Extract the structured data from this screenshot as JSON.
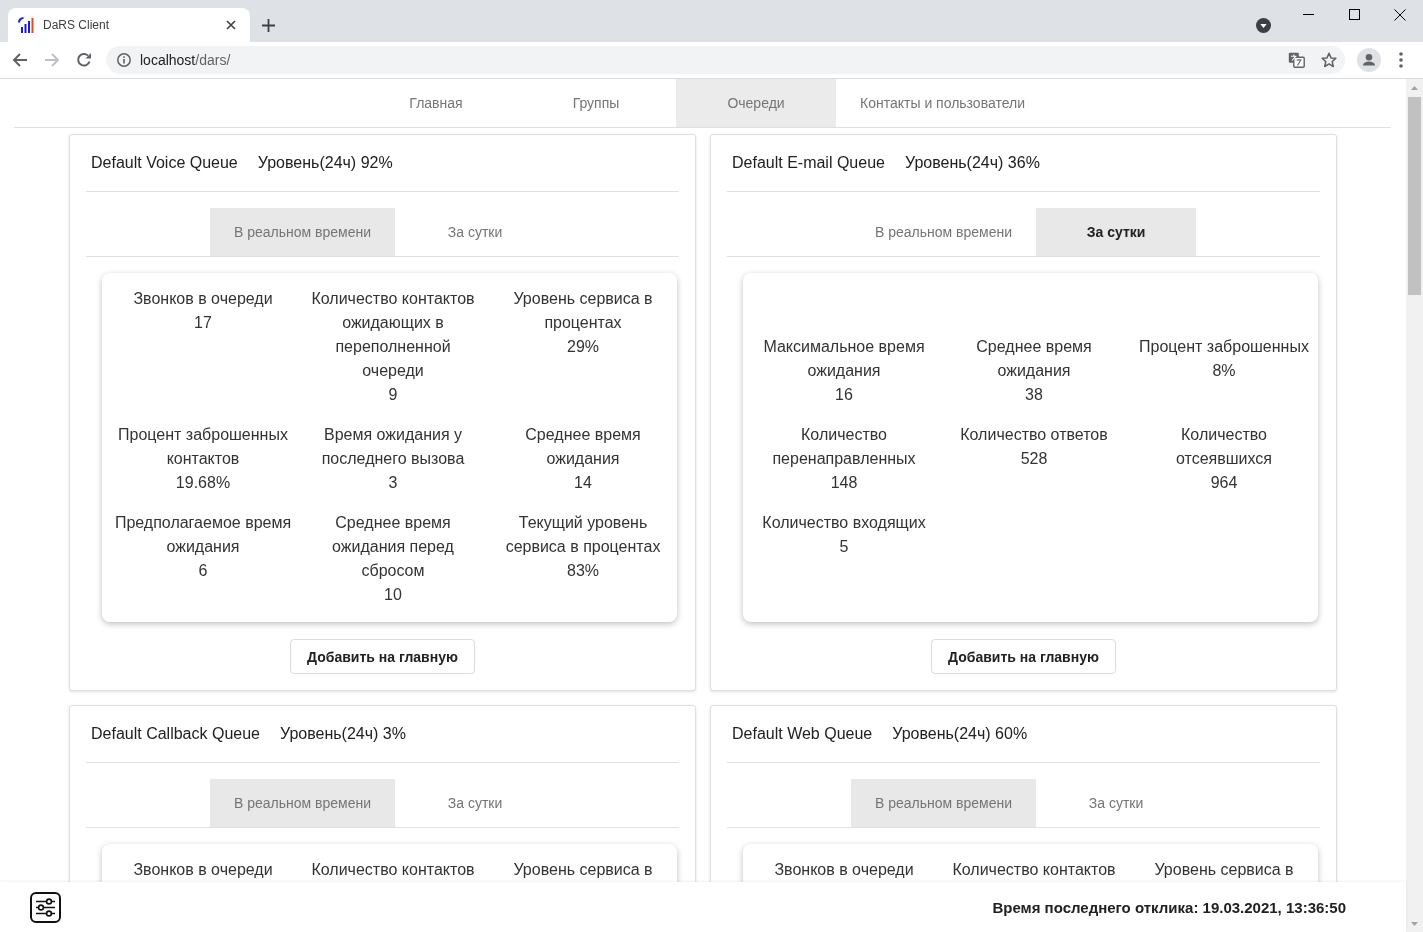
{
  "browser": {
    "tab": {
      "title": "DaRS Client"
    },
    "nav_buttons": [
      {
        "kind": "back",
        "disabled": false
      },
      {
        "kind": "forward",
        "disabled": true
      },
      {
        "kind": "reload",
        "disabled": false
      }
    ],
    "address": {
      "host": "localhost",
      "path": "/dars/"
    }
  },
  "nav": {
    "items": [
      {
        "label": "Главная",
        "selected": false
      },
      {
        "label": "Группы",
        "selected": false
      },
      {
        "label": "Очереди",
        "selected": true
      },
      {
        "label": "Контакты и пользователи",
        "selected": false
      }
    ]
  },
  "queues": [
    {
      "name": "Default Voice Queue",
      "service_level": "Уровень(24ч) 92%",
      "tabs": [
        {
          "label": "В реальном времени",
          "selected": true,
          "focused": false
        },
        {
          "label": "За сутки",
          "selected": false,
          "focused": false
        }
      ],
      "stats": [
        {
          "label": "Звонков в очереди",
          "value": "17"
        },
        {
          "label": "Количество контактов ожидающих в переполненной очереди",
          "value": "9"
        },
        {
          "label": "Уровень сервиса в процентах",
          "value": "29%"
        },
        {
          "label": "Процент заброшенных контактов",
          "value": "19.68%"
        },
        {
          "label": "Время ожидания у последнего вызова",
          "value": "3"
        },
        {
          "label": "Среднее время ожидания",
          "value": "14"
        },
        {
          "label": "Предполагаемое время ожидания",
          "value": "6"
        },
        {
          "label": "Среднее время ожидания перед сбросом",
          "value": "10"
        },
        {
          "label": "Текущий уровень сервиса в процентах",
          "value": "83%"
        }
      ],
      "button": "Добавить на главную"
    },
    {
      "name": "Default E-mail Queue",
      "service_level": "Уровень(24ч) 36%",
      "tabs": [
        {
          "label": "В реальном времени",
          "selected": false,
          "focused": false
        },
        {
          "label": "За сутки",
          "selected": true,
          "focused": true
        }
      ],
      "stats": [
        {
          "label": "Максимальное время ожидания",
          "value": "16"
        },
        {
          "label": "Среднее время ожидания",
          "value": "38"
        },
        {
          "label": "Процент заброшенных",
          "value": "8%"
        },
        {
          "label": "Количество перенаправленных",
          "value": "148"
        },
        {
          "label": "Количество ответов",
          "value": "528"
        },
        {
          "label": "Количество отсеявшихся",
          "value": "964"
        },
        {
          "label": "Количество входящих",
          "value": "5"
        }
      ],
      "button": "Добавить на главную"
    },
    {
      "name": "Default Callback Queue",
      "service_level": "Уровень(24ч) 3%",
      "tabs": [
        {
          "label": "В реальном времени",
          "selected": true,
          "focused": false
        },
        {
          "label": "За сутки",
          "selected": false,
          "focused": false
        }
      ],
      "stats": [
        {
          "label": "Звонков в очереди"
        },
        {
          "label": "Количество контактов"
        },
        {
          "label": "Уровень сервиса в"
        }
      ]
    },
    {
      "name": "Default Web Queue",
      "service_level": "Уровень(24ч) 60%",
      "tabs": [
        {
          "label": "В реальном времени",
          "selected": true,
          "focused": false
        },
        {
          "label": "За сутки",
          "selected": false,
          "focused": false
        }
      ],
      "stats": [
        {
          "label": "Звонков в очереди"
        },
        {
          "label": "Количество контактов"
        },
        {
          "label": "Уровень сервиса в"
        }
      ]
    }
  ],
  "status_bar": {
    "text": "Время последнего отклика: 19.03.2021, 13:36:50"
  }
}
